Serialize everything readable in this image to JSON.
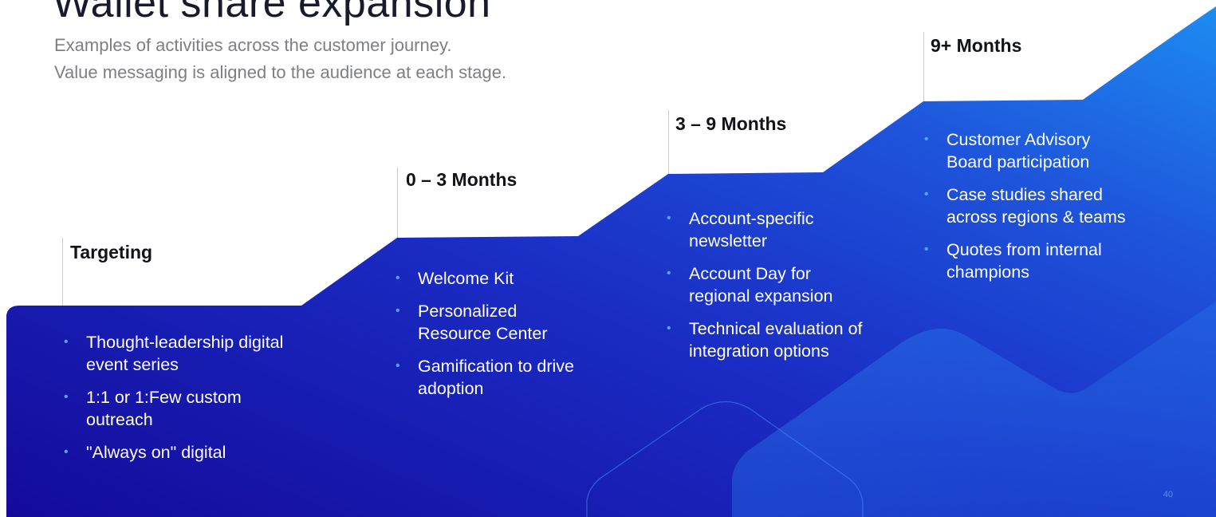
{
  "slide": {
    "title": "Wallet share expansion",
    "subtitle_line1": "Examples of activities across the customer journey.",
    "subtitle_line2": "Value messaging is aligned to the audience at each stage.",
    "page_number": "40"
  },
  "stages": [
    {
      "label": "Targeting",
      "activities": [
        "Thought-leadership digital event series",
        "1:1 or 1:Few custom outreach",
        "\"Always on\" digital"
      ]
    },
    {
      "label": "0 – 3 Months",
      "activities": [
        "Welcome Kit",
        "Personalized Resource Center",
        "Gamification to drive adoption"
      ]
    },
    {
      "label": "3 – 9 Months",
      "activities": [
        "Account-specific newsletter",
        "Account Day for regional expansion",
        "Technical evaluation of integration options"
      ]
    },
    {
      "label": "9+ Months",
      "activities": [
        "Customer Advisory Board participation",
        "Case studies shared across regions & teams",
        "Quotes from internal champions"
      ]
    }
  ],
  "colors": {
    "gradient_dark": "#140a9a",
    "gradient_mid": "#1e42d6",
    "gradient_light": "#1d8cf0",
    "bullet": "#4ea6ff"
  }
}
